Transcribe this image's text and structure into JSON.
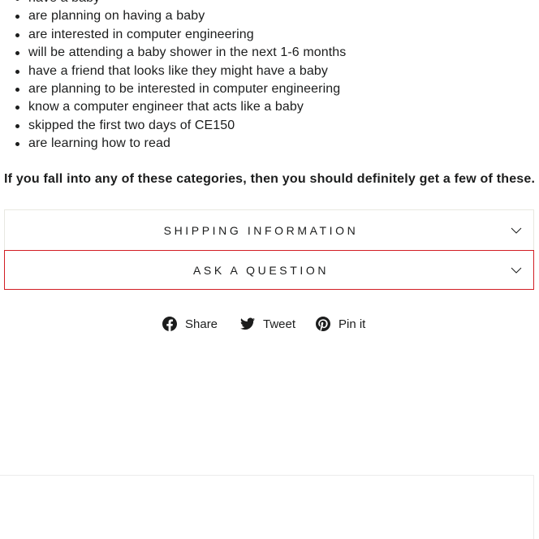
{
  "bullets": [
    "have a baby",
    "are planning on having a baby",
    "are interested in computer engineering",
    "will be attending a baby shower in the next 1-6 months",
    "have a friend that looks like they might have a baby",
    "are planning to be interested in computer engineering",
    "know a computer engineer that acts like a baby",
    "skipped the first two days of CE150",
    "are learning how to read"
  ],
  "category_note": "If you fall into any of these categories, then you should definitely get a few of these.",
  "accordions": {
    "shipping": {
      "label": "SHIPPING INFORMATION",
      "icon": "chevron-down-icon"
    },
    "question": {
      "label": "ASK A QUESTION",
      "icon": "chevron-down-icon",
      "highlight_color": "#d21e24"
    }
  },
  "share": {
    "facebook": {
      "label": "Share",
      "icon": "facebook-icon"
    },
    "twitter": {
      "label": "Tweet",
      "icon": "twitter-icon"
    },
    "pinterest": {
      "label": "Pin it",
      "icon": "pinterest-icon"
    }
  }
}
